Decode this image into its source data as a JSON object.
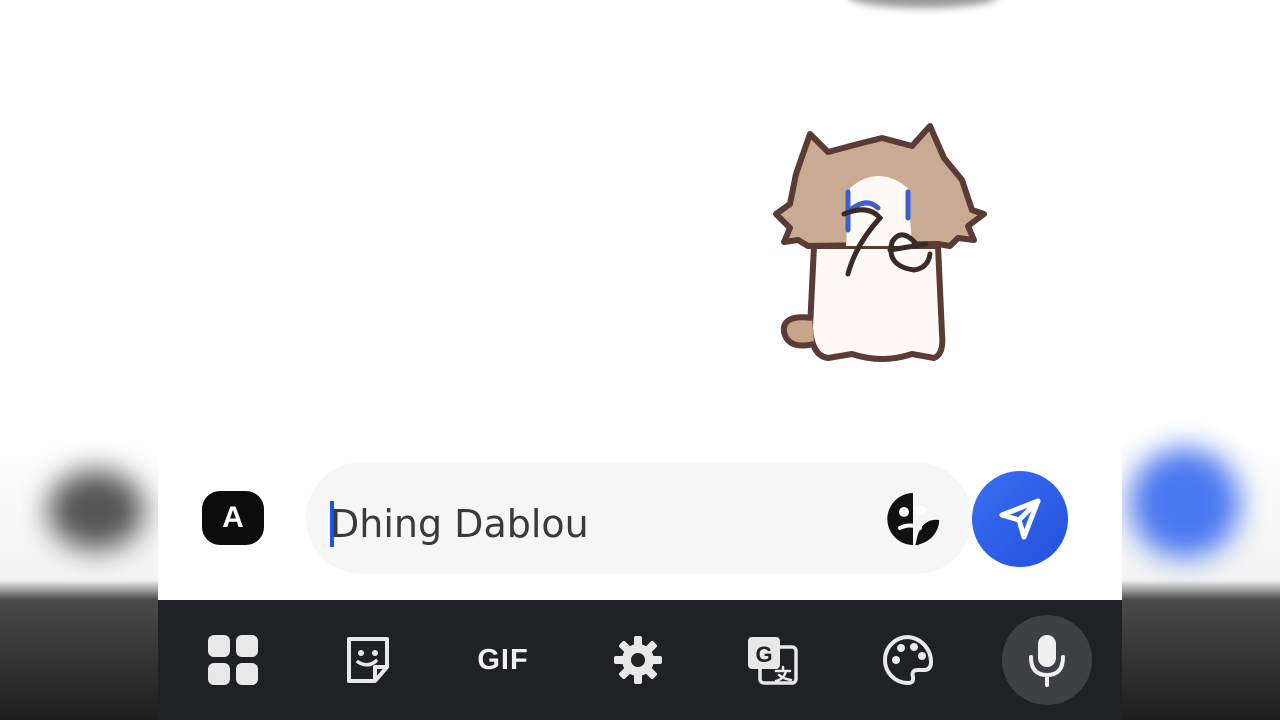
{
  "composer": {
    "input_text": "Dhing Dablou",
    "language_key_label": "A",
    "emoji_icon": "emoji-sticker-icon",
    "send_icon": "send-arrow-icon"
  },
  "sticker": {
    "icon": "cat-waving-hi-sticker"
  },
  "keyboard_toolbar": {
    "items": [
      {
        "icon": "grid-apps-icon"
      },
      {
        "icon": "sticker-icon"
      },
      {
        "label": "GIF"
      },
      {
        "icon": "gear-icon"
      },
      {
        "icon": "translate-icon"
      },
      {
        "icon": "palette-icon"
      },
      {
        "icon": "microphone-icon"
      }
    ]
  },
  "colors": {
    "accent": "#2d5ee8",
    "toolbar_bg": "#202124",
    "input_bg": "#f6f6f6",
    "caret": "#1a56e8"
  }
}
